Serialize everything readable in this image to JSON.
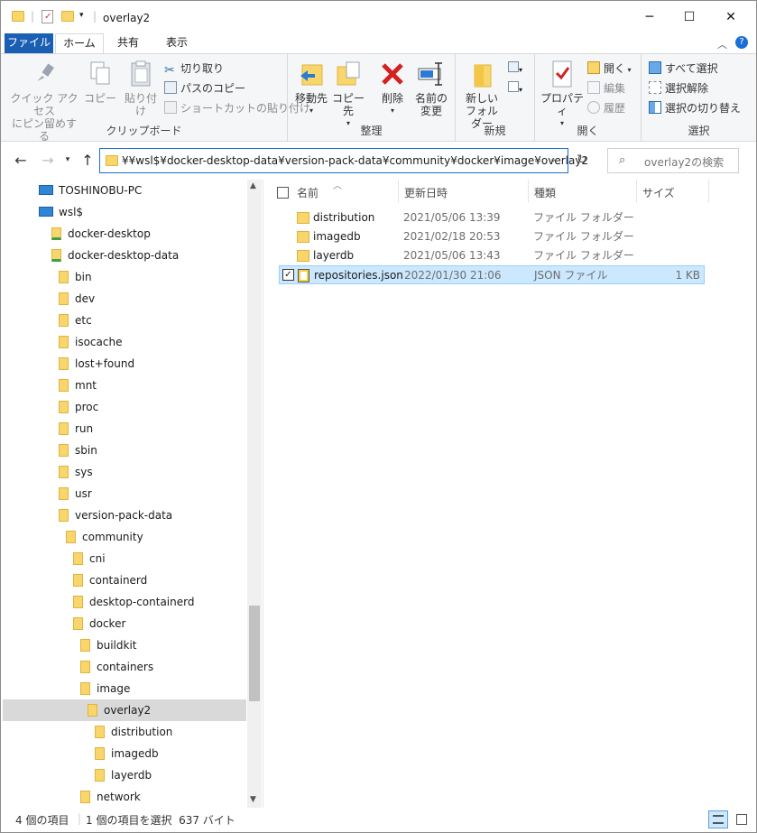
{
  "window": {
    "title": "overlay2",
    "minimize": "─",
    "maximize": "☐",
    "close": "✕"
  },
  "ribbon_tabs": {
    "file": "ファイル",
    "home": "ホーム",
    "share": "共有",
    "view": "表示"
  },
  "ribbon": {
    "clipboard": {
      "label": "クリップボード",
      "pin_line1": "クイック アクセス",
      "pin_line2": "にピン留めする",
      "copy": "コピー",
      "paste": "貼り付け",
      "cut": "切り取り",
      "copy_path": "パスのコピー",
      "paste_shortcut": "ショートカットの貼り付け"
    },
    "organize": {
      "label": "整理",
      "move_to": "移動先",
      "copy_to": "コピー先",
      "delete": "削除",
      "rename_line1": "名前の",
      "rename_line2": "変更"
    },
    "new": {
      "label": "新規",
      "new_folder_line1": "新しい",
      "new_folder_line2": "フォルダー"
    },
    "open": {
      "label": "開く",
      "properties": "プロパティ",
      "open": "開く",
      "edit": "編集",
      "history": "履歴"
    },
    "select": {
      "label": "選択",
      "select_all": "すべて選択",
      "select_none": "選択解除",
      "invert": "選択の切り替え"
    }
  },
  "address": {
    "path": "¥¥wsl$¥docker-desktop-data¥version-pack-data¥community¥docker¥image¥overlay2",
    "search_placeholder": "overlay2の検索"
  },
  "nav_tree": [
    {
      "label": "TOSHINOBU-PC",
      "kind": "pc"
    },
    {
      "label": "wsl$",
      "kind": "pc"
    },
    {
      "label": "docker-desktop",
      "kind": "netfolder"
    },
    {
      "label": "docker-desktop-data",
      "kind": "netfolder"
    },
    {
      "label": "bin",
      "kind": "folder"
    },
    {
      "label": "dev",
      "kind": "folder"
    },
    {
      "label": "etc",
      "kind": "folder"
    },
    {
      "label": "isocache",
      "kind": "folder"
    },
    {
      "label": "lost+found",
      "kind": "folder"
    },
    {
      "label": "mnt",
      "kind": "folder"
    },
    {
      "label": "proc",
      "kind": "folder"
    },
    {
      "label": "run",
      "kind": "folder"
    },
    {
      "label": "sbin",
      "kind": "folder"
    },
    {
      "label": "sys",
      "kind": "folder"
    },
    {
      "label": "usr",
      "kind": "folder"
    },
    {
      "label": "version-pack-data",
      "kind": "folder"
    },
    {
      "label": "community",
      "kind": "folder"
    },
    {
      "label": "cni",
      "kind": "folder"
    },
    {
      "label": "containerd",
      "kind": "folder"
    },
    {
      "label": "desktop-containerd",
      "kind": "folder"
    },
    {
      "label": "docker",
      "kind": "folder"
    },
    {
      "label": "buildkit",
      "kind": "folder"
    },
    {
      "label": "containers",
      "kind": "folder"
    },
    {
      "label": "image",
      "kind": "folder"
    },
    {
      "label": "overlay2",
      "kind": "folder",
      "selected": true
    },
    {
      "label": "distribution",
      "kind": "folder"
    },
    {
      "label": "imagedb",
      "kind": "folder"
    },
    {
      "label": "layerdb",
      "kind": "folder"
    },
    {
      "label": "network",
      "kind": "folder"
    }
  ],
  "columns": {
    "name": "名前",
    "date": "更新日時",
    "type": "種類",
    "size": "サイズ"
  },
  "files": [
    {
      "name": "distribution",
      "date": "2021/05/06 13:39",
      "type": "ファイル フォルダー",
      "size": "",
      "icon": "folder-icon"
    },
    {
      "name": "imagedb",
      "date": "2021/02/18 20:53",
      "type": "ファイル フォルダー",
      "size": "",
      "icon": "folder-icon"
    },
    {
      "name": "layerdb",
      "date": "2021/05/06 13:43",
      "type": "ファイル フォルダー",
      "size": "",
      "icon": "folder-icon"
    },
    {
      "name": "repositories.json",
      "date": "2022/01/30 21:06",
      "type": "JSON ファイル",
      "size": "1 KB",
      "icon": "json-file-icon",
      "selected": true
    }
  ],
  "status": {
    "item_count": "4 個の項目",
    "selection": "1 個の項目を選択  637 バイト"
  },
  "colors": {
    "accent": "#1a5fb4",
    "folder": "#f9d66b",
    "selected_row": "#cce8ff",
    "nav_selected": "#d9d9d9"
  }
}
